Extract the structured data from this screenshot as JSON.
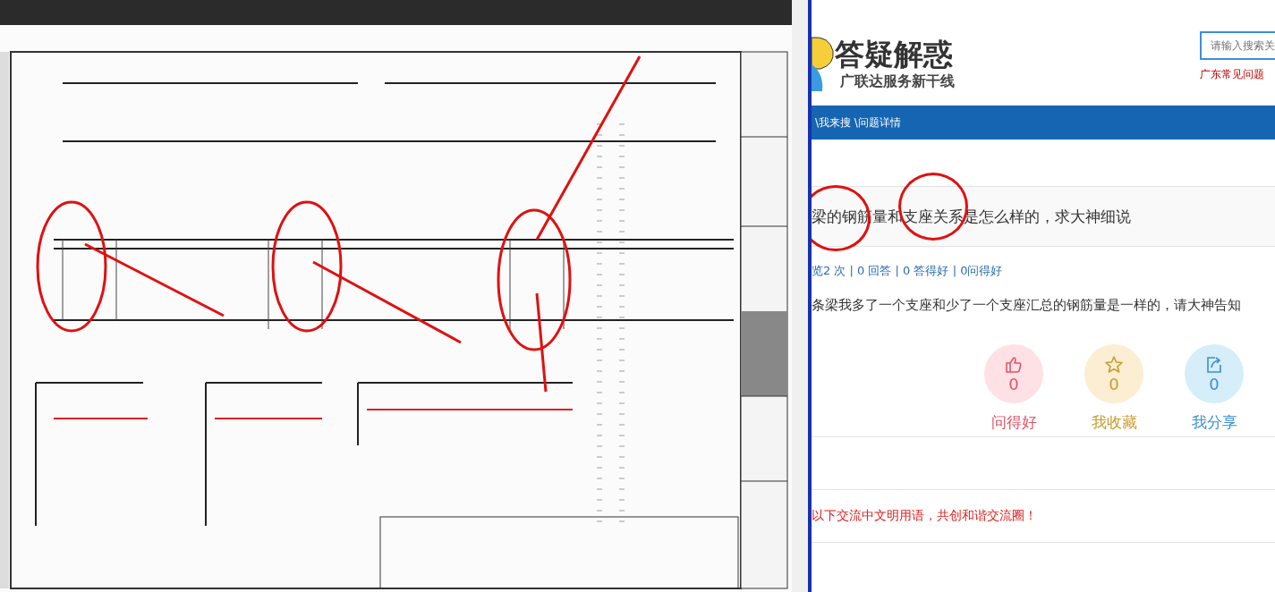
{
  "logo": {
    "title": "答疑解惑",
    "subtitle": "广联达服务新干线"
  },
  "search": {
    "placeholder": "请输入搜索关"
  },
  "region_link": "广东常见问题",
  "breadcrumb": "\\我来搜 \\问题详情",
  "question": {
    "title": "梁的钢筋量和支座关系是怎么样的，求大神细说",
    "stats": "览2 次 | 0 回答 | 0 答得好 | 0问得好",
    "body": "条梁我多了一个支座和少了一个支座汇总的钢筋量是一样的，请大神告知"
  },
  "actions": [
    {
      "kind": "thumb",
      "count": "0",
      "label": "问得好",
      "color": "#fde1e5"
    },
    {
      "kind": "star",
      "count": "0",
      "label": "我收藏",
      "color": "#fbeed2"
    },
    {
      "kind": "share",
      "count": "0",
      "label": "我分享",
      "color": "#d6edfa"
    }
  ],
  "notice": "以下交流中文明用语，共创和谐交流圈！"
}
